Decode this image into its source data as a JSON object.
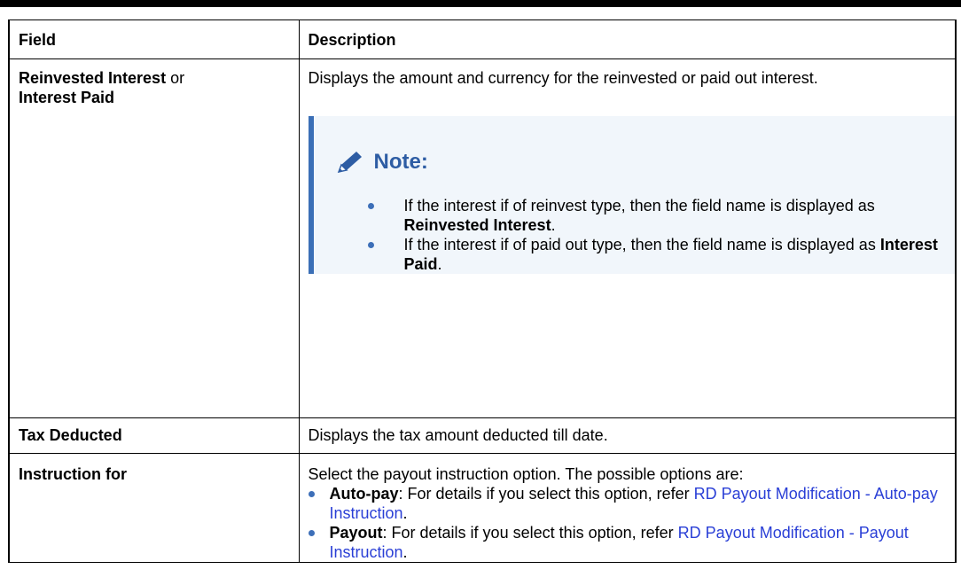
{
  "table": {
    "headers": {
      "field": "Field",
      "description": "Description"
    },
    "rows": {
      "interest": {
        "field_bold_1": "Reinvested Interest",
        "field_or": " or",
        "field_bold_2": "Interest Paid",
        "description": "Displays the amount and currency for the reinvested or paid out interest.",
        "note": {
          "title": "Note:",
          "icon": "pencil-icon",
          "items": [
            {
              "text": "If the interest if of reinvest type, then the field name is displayed as ",
              "bold": "Reinvested Interest",
              "end": "."
            },
            {
              "text": "If the interest if of paid out type, then the field name is displayed as ",
              "bold": "Interest Paid",
              "end": "."
            }
          ]
        }
      },
      "tax": {
        "field": "Tax Deducted",
        "description": "Displays the tax amount deducted till date."
      },
      "instruction": {
        "field": "Instruction for",
        "description": "Select the payout instruction option. The possible options are:",
        "options": [
          {
            "bold": "Auto-pay",
            "text": ": For details if you select this option, refer ",
            "link": "RD Payout Modification - Auto-pay Instruction",
            "end": "."
          },
          {
            "bold": "Payout",
            "text": ": For details if you select this option, refer ",
            "link": "RD Payout Modification - Payout Instruction",
            "end": "."
          }
        ]
      }
    }
  },
  "colors": {
    "link": "#2a3fd6",
    "note_accent": "#3b6fb6",
    "note_bg": "#f1f6fb",
    "bullet": "#3d6fb8"
  }
}
